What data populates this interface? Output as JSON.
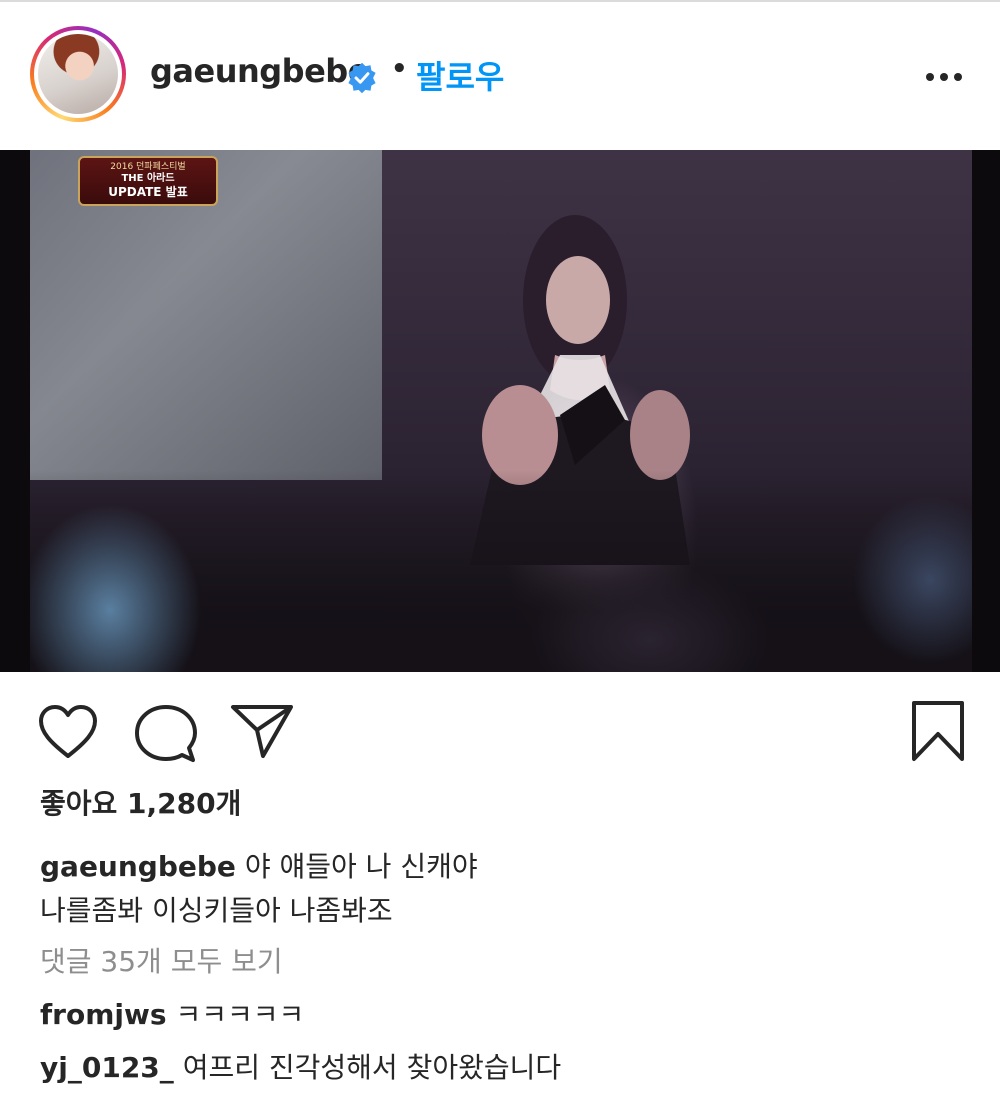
{
  "post": {
    "username": "gaeungbebe",
    "verified": true,
    "separator": "•",
    "follow_label": "팔로우",
    "media": {
      "overlay_badge": {
        "line1": "2016 던파페스티벌",
        "line2": "THE 아라드",
        "line3": "UPDATE 발표"
      }
    },
    "actions": {
      "like_icon": "heart-icon",
      "comment_icon": "comment-icon",
      "share_icon": "paper-plane-icon",
      "save_icon": "bookmark-icon"
    },
    "likes_text": "좋아요 1,280개",
    "caption": {
      "username": "gaeungbebe",
      "line1": "야 얘들아 나 신캐야",
      "line2": "나를좀봐 이싱키들아 나좀봐조"
    },
    "view_all_comments": "댓글 35개 모두 보기",
    "comments": [
      {
        "username": "fromjws",
        "text": "ㅋㅋㅋㅋㅋ"
      },
      {
        "username": "yj_0123_",
        "text": "여프리 진각성해서 찾아왔습니다"
      }
    ],
    "colors": {
      "accent": "#0095f6",
      "text": "#262626",
      "muted": "#8e8e8e"
    }
  }
}
